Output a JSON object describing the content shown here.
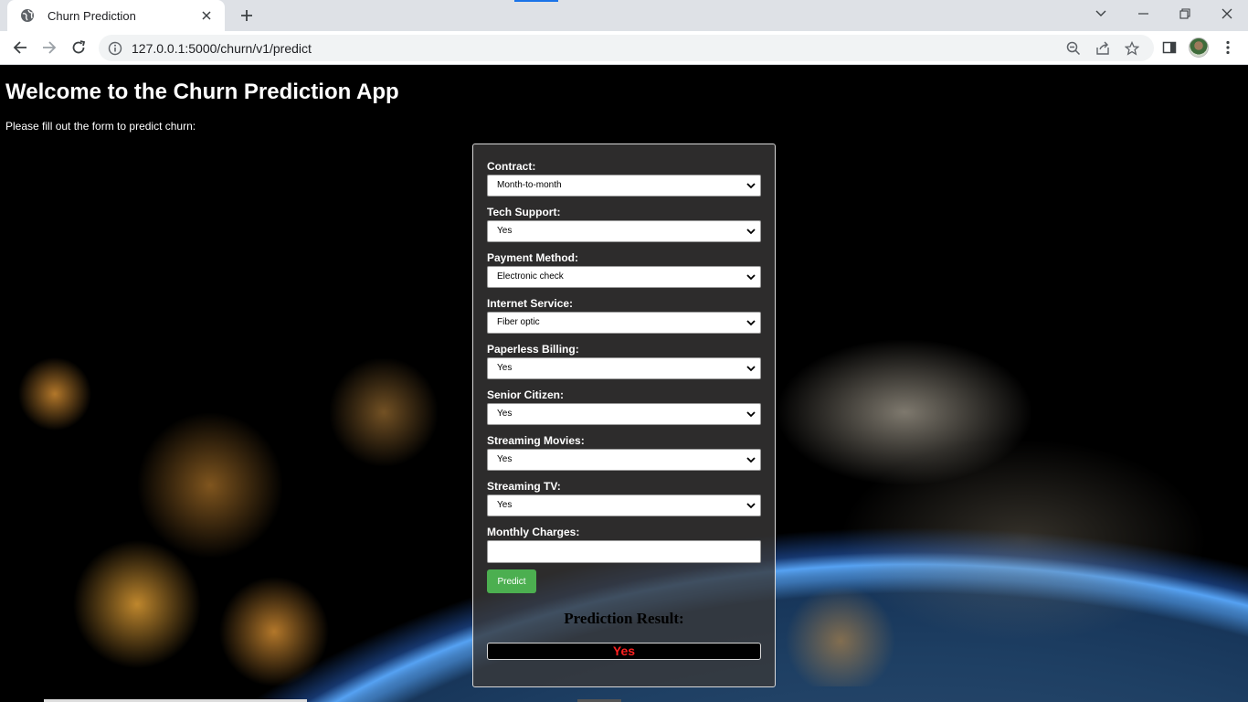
{
  "browser": {
    "tab_title": "Churn Prediction",
    "url": "127.0.0.1:5000/churn/v1/predict",
    "icons": [
      "globe-icon",
      "close-icon",
      "plus-icon",
      "chevron-down-icon",
      "minimize-icon",
      "restore-icon",
      "close-window-icon",
      "back-arrow-icon",
      "forward-arrow-icon",
      "reload-icon",
      "info-icon",
      "zoom-icon",
      "share-icon",
      "star-icon",
      "side-panel-icon",
      "profile-avatar",
      "menu-dots-icon"
    ]
  },
  "page": {
    "title": "Welcome to the Churn Prediction App",
    "subtitle": "Please fill out the form to predict churn:"
  },
  "form": {
    "fields": [
      {
        "label": "Contract:",
        "value": "Month-to-month"
      },
      {
        "label": "Tech Support:",
        "value": "Yes"
      },
      {
        "label": "Payment Method:",
        "value": "Electronic check"
      },
      {
        "label": "Internet Service:",
        "value": "Fiber optic"
      },
      {
        "label": "Paperless Billing:",
        "value": "Yes"
      },
      {
        "label": "Senior Citizen:",
        "value": "Yes"
      },
      {
        "label": "Streaming Movies:",
        "value": "Yes"
      },
      {
        "label": "Streaming TV:",
        "value": "Yes"
      }
    ],
    "monthly_charges": {
      "label": "Monthly Charges:",
      "value": ""
    },
    "predict_label": "Predict",
    "result_heading": "Prediction Result:",
    "result_value": "Yes"
  },
  "colors": {
    "predict_button": "#4caf50",
    "result_text": "#ff2020",
    "card_background": "#3a3838"
  }
}
